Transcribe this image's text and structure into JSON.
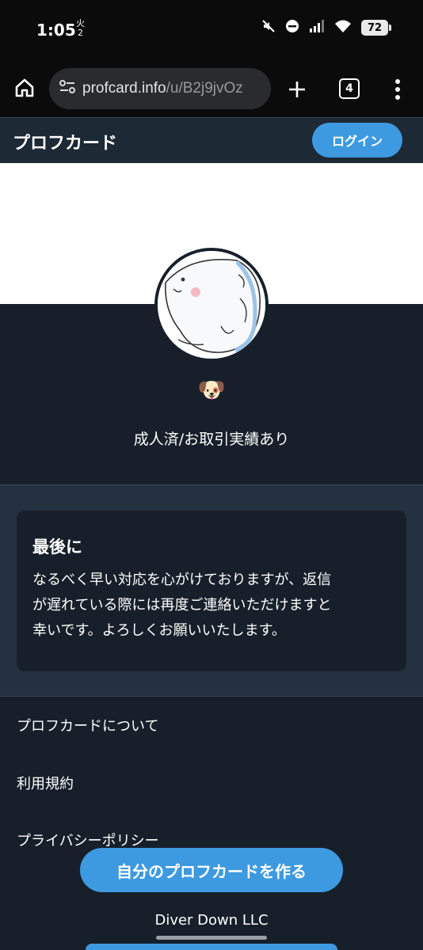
{
  "status_bar": {
    "time": "1:05",
    "indicator_top": "火",
    "indicator_bottom": "2",
    "battery": "72",
    "icons": [
      "mute-icon",
      "dnd-icon",
      "signal-icon",
      "wifi-icon",
      "battery-icon"
    ]
  },
  "browser": {
    "url_domain": "profcard.info",
    "url_path": "/u/B2j9jvOz",
    "tab_count": "4",
    "icons": [
      "home-icon",
      "site-settings-icon",
      "plus-icon",
      "tabs-icon",
      "more-vert-icon"
    ]
  },
  "header": {
    "title": "プロフカード",
    "login_label": "ログイン"
  },
  "profile": {
    "emoji": "🐶",
    "bio": "成人済/お取引実績あり"
  },
  "closing": {
    "title": "最後に",
    "lines": [
      "なるべく早い対応を心がけておりますが、返信",
      "が遅れている際には再度ご連絡いただけますと",
      "幸いです。よろしくお願いいたします。"
    ]
  },
  "footer": {
    "links": [
      "プロフカードについて",
      "利用規約",
      "プライバシーポリシー"
    ],
    "cta_label": "自分のプロフカードを作る",
    "company": "Diver Down LLC"
  },
  "colors": {
    "accent": "#3d9ae0",
    "background": "#17202a",
    "header_bg": "#1d2935",
    "section_bg": "#243140"
  }
}
